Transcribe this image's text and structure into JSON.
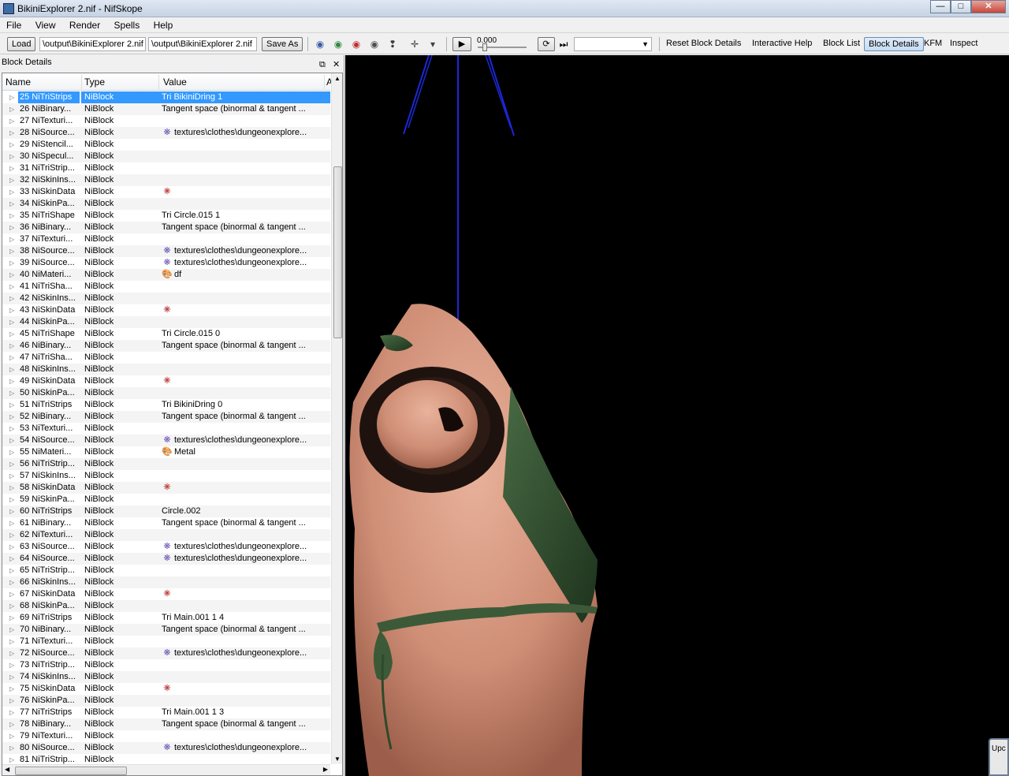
{
  "window": {
    "title": "BikiniExplorer 2.nif - NifSkope",
    "minimize": "—",
    "maximize": "□",
    "close": "✕"
  },
  "menu": [
    "File",
    "View",
    "Render",
    "Spells",
    "Help"
  ],
  "toolbar": {
    "load_label": "Load",
    "load_path": "\\output\\BikiniExplorer 2.nif",
    "save_path": "\\output\\BikiniExplorer 2.nif",
    "save_as_label": "Save As",
    "time_value": "0.000",
    "reset_block_details": "Reset Block Details",
    "interactive_help": "Interactive Help",
    "block_list": "Block List",
    "block_details": "Block Details",
    "kfm": "KFM",
    "inspect": "Inspect"
  },
  "panel": {
    "title": "Block Details",
    "columns": {
      "name": "Name",
      "type": "Type",
      "value": "Value",
      "extra": "A"
    }
  },
  "rows": [
    {
      "name": "25 NiTriStrips",
      "type": "NiBlock",
      "value": "Tri BikiniDring 1",
      "icon": "",
      "selected": true
    },
    {
      "name": "26 NiBinary...",
      "type": "NiBlock",
      "value": "Tangent space (binormal & tangent ...",
      "icon": ""
    },
    {
      "name": "27 NiTexturi...",
      "type": "NiBlock",
      "value": "",
      "icon": ""
    },
    {
      "name": "28 NiSource...",
      "type": "NiBlock",
      "value": "textures\\clothes\\dungeonexplore...",
      "icon": "texture-icon"
    },
    {
      "name": "29 NiStencil...",
      "type": "NiBlock",
      "value": "",
      "icon": ""
    },
    {
      "name": "30 NiSpecul...",
      "type": "NiBlock",
      "value": "",
      "icon": ""
    },
    {
      "name": "31 NiTriStrip...",
      "type": "NiBlock",
      "value": "",
      "icon": ""
    },
    {
      "name": "32 NiSkinIns...",
      "type": "NiBlock",
      "value": "",
      "icon": ""
    },
    {
      "name": "33 NiSkinData",
      "type": "NiBlock",
      "value": "",
      "icon": "skin-icon"
    },
    {
      "name": "34 NiSkinPa...",
      "type": "NiBlock",
      "value": "",
      "icon": ""
    },
    {
      "name": "35 NiTriShape",
      "type": "NiBlock",
      "value": "Tri Circle.015 1",
      "icon": ""
    },
    {
      "name": "36 NiBinary...",
      "type": "NiBlock",
      "value": "Tangent space (binormal & tangent ...",
      "icon": ""
    },
    {
      "name": "37 NiTexturi...",
      "type": "NiBlock",
      "value": "",
      "icon": ""
    },
    {
      "name": "38 NiSource...",
      "type": "NiBlock",
      "value": "textures\\clothes\\dungeonexplore...",
      "icon": "texture-icon"
    },
    {
      "name": "39 NiSource...",
      "type": "NiBlock",
      "value": "textures\\clothes\\dungeonexplore...",
      "icon": "texture-icon"
    },
    {
      "name": "40 NiMateri...",
      "type": "NiBlock",
      "value": "df",
      "icon": "material-icon"
    },
    {
      "name": "41 NiTriSha...",
      "type": "NiBlock",
      "value": "",
      "icon": ""
    },
    {
      "name": "42 NiSkinIns...",
      "type": "NiBlock",
      "value": "",
      "icon": ""
    },
    {
      "name": "43 NiSkinData",
      "type": "NiBlock",
      "value": "",
      "icon": "skin-icon"
    },
    {
      "name": "44 NiSkinPa...",
      "type": "NiBlock",
      "value": "",
      "icon": ""
    },
    {
      "name": "45 NiTriShape",
      "type": "NiBlock",
      "value": "Tri Circle.015 0",
      "icon": ""
    },
    {
      "name": "46 NiBinary...",
      "type": "NiBlock",
      "value": "Tangent space (binormal & tangent ...",
      "icon": ""
    },
    {
      "name": "47 NiTriSha...",
      "type": "NiBlock",
      "value": "",
      "icon": ""
    },
    {
      "name": "48 NiSkinIns...",
      "type": "NiBlock",
      "value": "",
      "icon": ""
    },
    {
      "name": "49 NiSkinData",
      "type": "NiBlock",
      "value": "",
      "icon": "skin-icon"
    },
    {
      "name": "50 NiSkinPa...",
      "type": "NiBlock",
      "value": "",
      "icon": ""
    },
    {
      "name": "51 NiTriStrips",
      "type": "NiBlock",
      "value": "Tri BikiniDring 0",
      "icon": ""
    },
    {
      "name": "52 NiBinary...",
      "type": "NiBlock",
      "value": "Tangent space (binormal & tangent ...",
      "icon": ""
    },
    {
      "name": "53 NiTexturi...",
      "type": "NiBlock",
      "value": "",
      "icon": ""
    },
    {
      "name": "54 NiSource...",
      "type": "NiBlock",
      "value": "textures\\clothes\\dungeonexplore...",
      "icon": "texture-icon"
    },
    {
      "name": "55 NiMateri...",
      "type": "NiBlock",
      "value": "Metal",
      "icon": "material-icon"
    },
    {
      "name": "56 NiTriStrip...",
      "type": "NiBlock",
      "value": "",
      "icon": ""
    },
    {
      "name": "57 NiSkinIns...",
      "type": "NiBlock",
      "value": "",
      "icon": ""
    },
    {
      "name": "58 NiSkinData",
      "type": "NiBlock",
      "value": "",
      "icon": "skin-icon"
    },
    {
      "name": "59 NiSkinPa...",
      "type": "NiBlock",
      "value": "",
      "icon": ""
    },
    {
      "name": "60 NiTriStrips",
      "type": "NiBlock",
      "value": "Circle.002",
      "icon": ""
    },
    {
      "name": "61 NiBinary...",
      "type": "NiBlock",
      "value": "Tangent space (binormal & tangent ...",
      "icon": ""
    },
    {
      "name": "62 NiTexturi...",
      "type": "NiBlock",
      "value": "",
      "icon": ""
    },
    {
      "name": "63 NiSource...",
      "type": "NiBlock",
      "value": "textures\\clothes\\dungeonexplore...",
      "icon": "texture-icon"
    },
    {
      "name": "64 NiSource...",
      "type": "NiBlock",
      "value": "textures\\clothes\\dungeonexplore...",
      "icon": "texture-icon"
    },
    {
      "name": "65 NiTriStrip...",
      "type": "NiBlock",
      "value": "",
      "icon": ""
    },
    {
      "name": "66 NiSkinIns...",
      "type": "NiBlock",
      "value": "",
      "icon": ""
    },
    {
      "name": "67 NiSkinData",
      "type": "NiBlock",
      "value": "",
      "icon": "skin-icon"
    },
    {
      "name": "68 NiSkinPa...",
      "type": "NiBlock",
      "value": "",
      "icon": ""
    },
    {
      "name": "69 NiTriStrips",
      "type": "NiBlock",
      "value": "Tri Main.001 1 4",
      "icon": ""
    },
    {
      "name": "70 NiBinary...",
      "type": "NiBlock",
      "value": "Tangent space (binormal & tangent ...",
      "icon": ""
    },
    {
      "name": "71 NiTexturi...",
      "type": "NiBlock",
      "value": "",
      "icon": ""
    },
    {
      "name": "72 NiSource...",
      "type": "NiBlock",
      "value": "textures\\clothes\\dungeonexplore...",
      "icon": "texture-icon"
    },
    {
      "name": "73 NiTriStrip...",
      "type": "NiBlock",
      "value": "",
      "icon": ""
    },
    {
      "name": "74 NiSkinIns...",
      "type": "NiBlock",
      "value": "",
      "icon": ""
    },
    {
      "name": "75 NiSkinData",
      "type": "NiBlock",
      "value": "",
      "icon": "skin-icon"
    },
    {
      "name": "76 NiSkinPa...",
      "type": "NiBlock",
      "value": "",
      "icon": ""
    },
    {
      "name": "77 NiTriStrips",
      "type": "NiBlock",
      "value": "Tri Main.001 1 3",
      "icon": ""
    },
    {
      "name": "78 NiBinary...",
      "type": "NiBlock",
      "value": "Tangent space (binormal & tangent ...",
      "icon": ""
    },
    {
      "name": "79 NiTexturi...",
      "type": "NiBlock",
      "value": "",
      "icon": ""
    },
    {
      "name": "80 NiSource...",
      "type": "NiBlock",
      "value": "textures\\clothes\\dungeonexplore...",
      "icon": "texture-icon"
    },
    {
      "name": "81 NiTriStrip...",
      "type": "NiBlock",
      "value": "",
      "icon": ""
    }
  ],
  "viewport": {
    "background": "#000000",
    "popup_label": "Upc"
  },
  "colors": {
    "selection": "#3399ff",
    "axis_blue": "#1c28d8",
    "skin": "#d7967e",
    "strap_green": "#2c4a2a",
    "ring_dark": "#2a1a14"
  }
}
